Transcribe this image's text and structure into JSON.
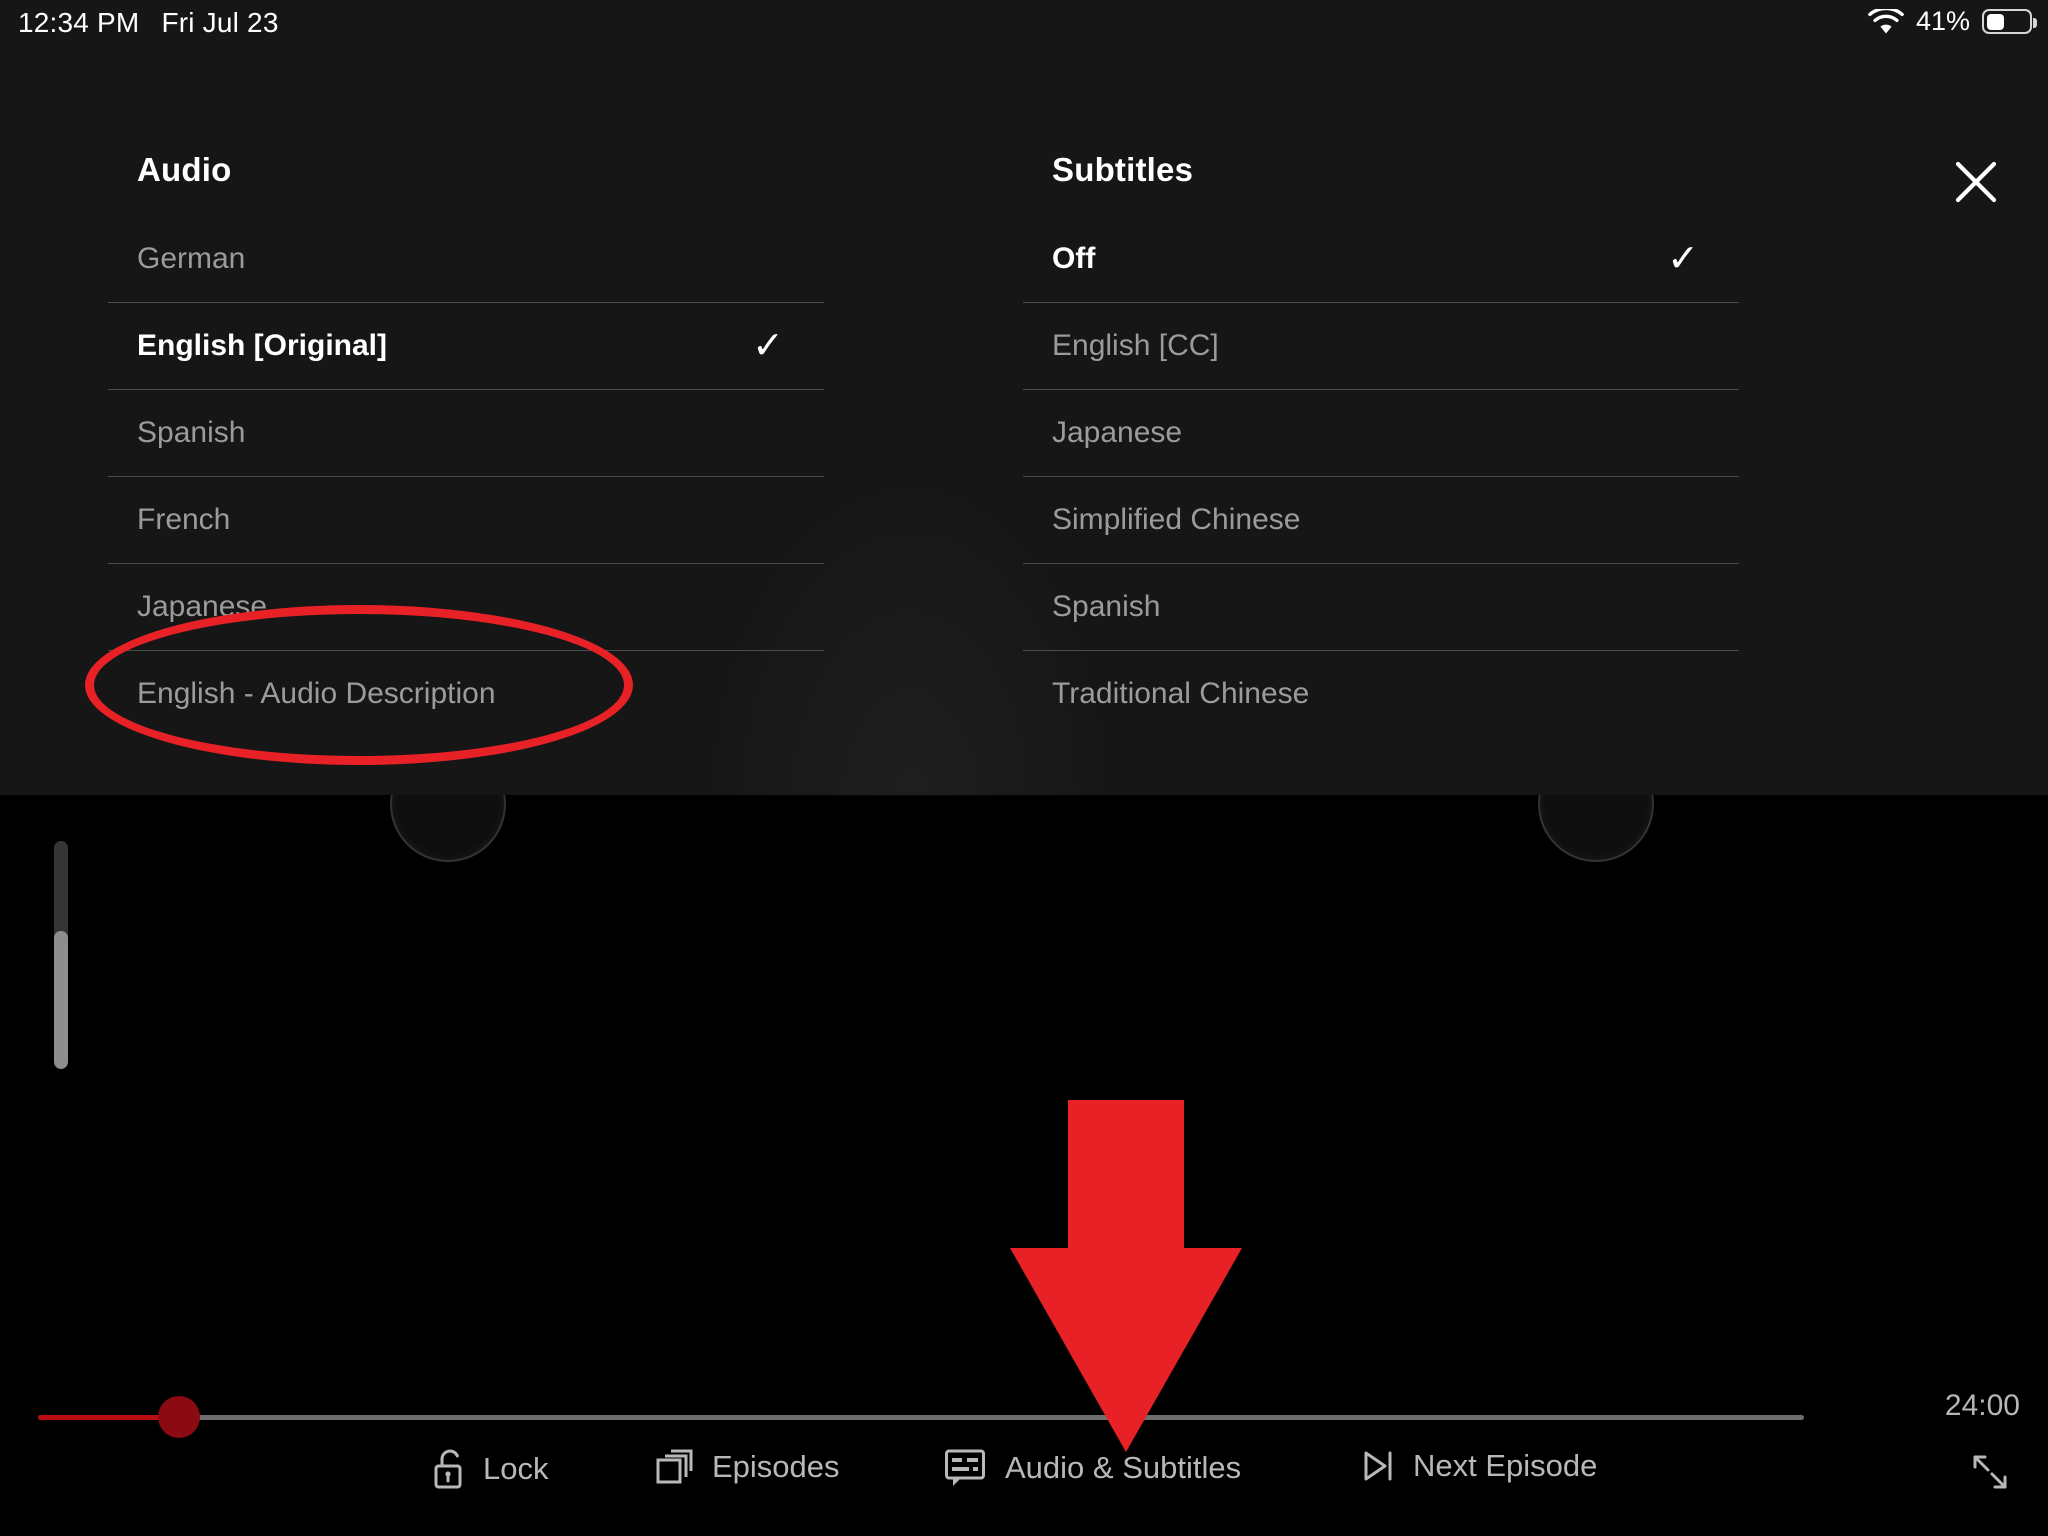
{
  "status_bar": {
    "time": "12:34 PM",
    "date": "Fri Jul 23",
    "battery_percent": "41%",
    "wifi_icon": "wifi-icon",
    "battery_icon": "battery-icon"
  },
  "overlay": {
    "close_icon": "close-icon",
    "audio": {
      "title": "Audio",
      "options": [
        {
          "label": "German",
          "selected": false,
          "check": ""
        },
        {
          "label": "English [Original]",
          "selected": true,
          "check": "✓"
        },
        {
          "label": "Spanish",
          "selected": false,
          "check": ""
        },
        {
          "label": "French",
          "selected": false,
          "check": ""
        },
        {
          "label": "Japanese",
          "selected": false,
          "check": ""
        },
        {
          "label": "English - Audio Description",
          "selected": false,
          "check": ""
        }
      ]
    },
    "subtitles": {
      "title": "Subtitles",
      "options": [
        {
          "label": "Off",
          "selected": true,
          "check": "✓"
        },
        {
          "label": "English [CC]",
          "selected": false,
          "check": ""
        },
        {
          "label": "Japanese",
          "selected": false,
          "check": ""
        },
        {
          "label": "Simplified Chinese",
          "selected": false,
          "check": ""
        },
        {
          "label": "Spanish",
          "selected": false,
          "check": ""
        },
        {
          "label": "Traditional Chinese",
          "selected": false,
          "check": ""
        }
      ]
    }
  },
  "player": {
    "time_remaining": "24:00",
    "progress_percent": 8,
    "brightness_slider": "vertical-brightness-slider",
    "controls": [
      {
        "id": "lock",
        "label": "Lock",
        "icon": "unlock-icon"
      },
      {
        "id": "episodes",
        "label": "Episodes",
        "icon": "episodes-icon"
      },
      {
        "id": "audio-subtitles",
        "label": "Audio & Subtitles",
        "icon": "audio-subtitles-icon"
      },
      {
        "id": "next-episode",
        "label": "Next Episode",
        "icon": "skip-next-icon"
      }
    ],
    "expand_icon": "expand-icon"
  },
  "annotations": {
    "ellipse": {
      "target": "English - Audio Description",
      "color": "#e82127"
    },
    "arrow": {
      "target": "Audio & Subtitles",
      "color": "#e82127",
      "direction": "down"
    }
  },
  "colors": {
    "panel_background": "#161616",
    "video_background": "#000000",
    "accent_red": "#e82127",
    "progress_red": "#b90d13",
    "knob_red": "#8c0a11",
    "muted_text": "#9b9b9b",
    "divider": "#4b4b4b"
  }
}
